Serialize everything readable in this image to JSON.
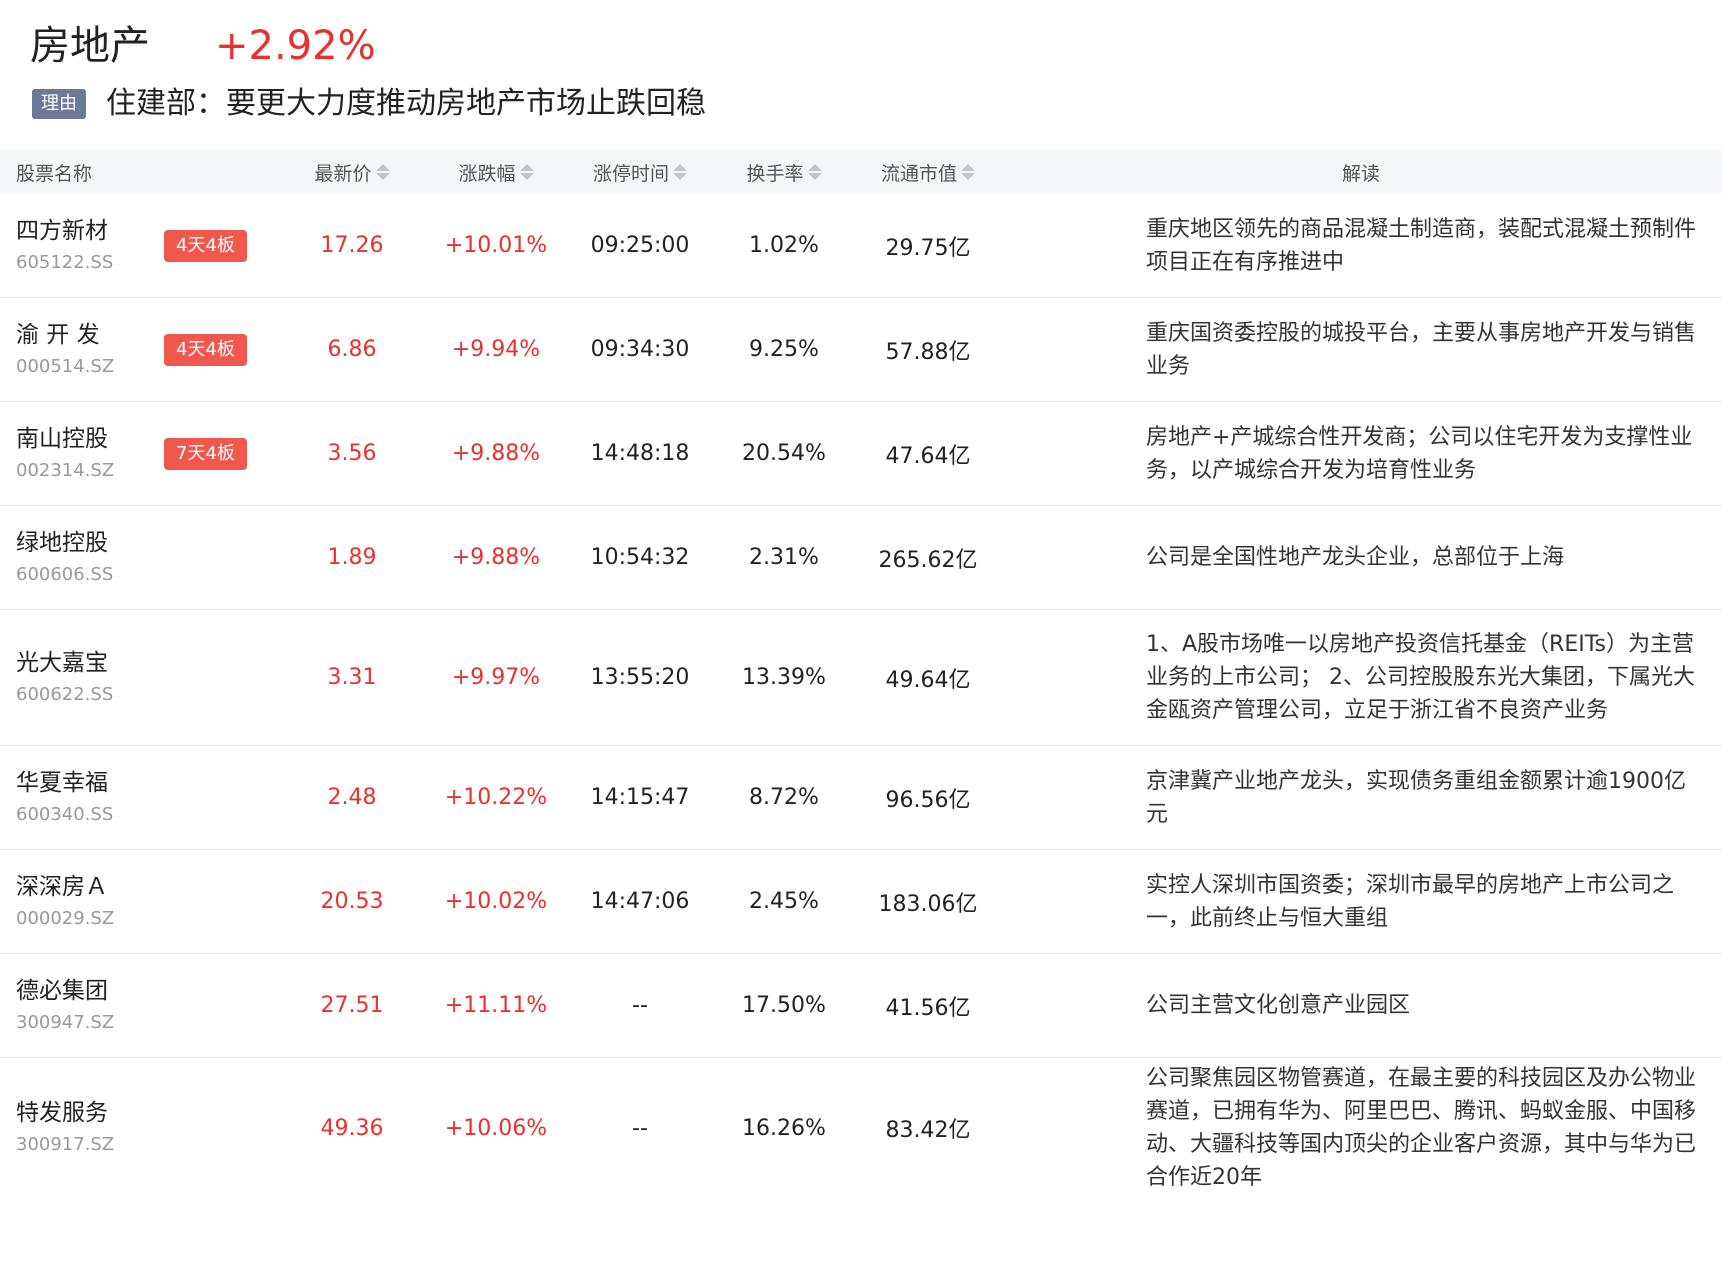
{
  "header": {
    "title": "房地产",
    "change": "+2.92%",
    "reason_tag": "理由",
    "reason_text": "住建部：要更大力度推动房地产市场止跌回稳"
  },
  "columns": {
    "name": "股票名称",
    "price": "最新价",
    "change": "涨跌幅",
    "limit_time": "涨停时间",
    "turnover": "换手率",
    "float_cap": "流通市值",
    "desc": "解读"
  },
  "colors": {
    "up": "#e8312f",
    "badge": "#f0574d",
    "reason_tag": "#6b7a99",
    "header_bg": "#f5f6f7"
  },
  "rows": [
    {
      "name": "四方新材",
      "code": "605122.SS",
      "badge": "4天4板",
      "price": "17.26",
      "change": "+10.01%",
      "time": "09:25:00",
      "turnover": "1.02%",
      "cap": "29.75亿",
      "desc": "重庆地区领先的商品混凝土制造商，装配式混凝土预制件项目正在有序推进中"
    },
    {
      "name": "渝 开 发",
      "code": "000514.SZ",
      "badge": "4天4板",
      "price": "6.86",
      "change": "+9.94%",
      "time": "09:34:30",
      "turnover": "9.25%",
      "cap": "57.88亿",
      "desc": "重庆国资委控股的城投平台，主要从事房地产开发与销售业务"
    },
    {
      "name": "南山控股",
      "code": "002314.SZ",
      "badge": "7天4板",
      "price": "3.56",
      "change": "+9.88%",
      "time": "14:48:18",
      "turnover": "20.54%",
      "cap": "47.64亿",
      "desc": "房地产+产城综合性开发商；公司以住宅开发为支撑性业务，以产城综合开发为培育性业务"
    },
    {
      "name": "绿地控股",
      "code": "600606.SS",
      "badge": "",
      "price": "1.89",
      "change": "+9.88%",
      "time": "10:54:32",
      "turnover": "2.31%",
      "cap": "265.62亿",
      "desc": "公司是全国性地产龙头企业，总部位于上海"
    },
    {
      "name": "光大嘉宝",
      "code": "600622.SS",
      "badge": "",
      "price": "3.31",
      "change": "+9.97%",
      "time": "13:55:20",
      "turnover": "13.39%",
      "cap": "49.64亿",
      "desc": "1、A股市场唯一以房地产投资信托基金（REITs）为主营业务的上市公司； 2、公司控股股东光大集团，下属光大金瓯资产管理公司，立足于浙江省不良资产业务"
    },
    {
      "name": "华夏幸福",
      "code": "600340.SS",
      "badge": "",
      "price": "2.48",
      "change": "+10.22%",
      "time": "14:15:47",
      "turnover": "8.72%",
      "cap": "96.56亿",
      "desc": "京津冀产业地产龙头，实现债务重组金额累计逾1900亿元"
    },
    {
      "name": "深深房Ａ",
      "code": "000029.SZ",
      "badge": "",
      "price": "20.53",
      "change": "+10.02%",
      "time": "14:47:06",
      "turnover": "2.45%",
      "cap": "183.06亿",
      "desc": "实控人深圳市国资委；深圳市最早的房地产上市公司之一，此前终止与恒大重组"
    },
    {
      "name": "德必集团",
      "code": "300947.SZ",
      "badge": "",
      "price": "27.51",
      "change": "+11.11%",
      "time": "--",
      "turnover": "17.50%",
      "cap": "41.56亿",
      "desc": "公司主营文化创意产业园区"
    },
    {
      "name": "特发服务",
      "code": "300917.SZ",
      "badge": "",
      "price": "49.36",
      "change": "+10.06%",
      "time": "--",
      "turnover": "16.26%",
      "cap": "83.42亿",
      "desc": "公司聚焦园区物管赛道，在最主要的科技园区及办公物业赛道，已拥有华为、阿里巴巴、腾讯、蚂蚁金服、中国移动、大疆科技等国内顶尖的企业客户资源，其中与华为已合作近20年"
    }
  ]
}
